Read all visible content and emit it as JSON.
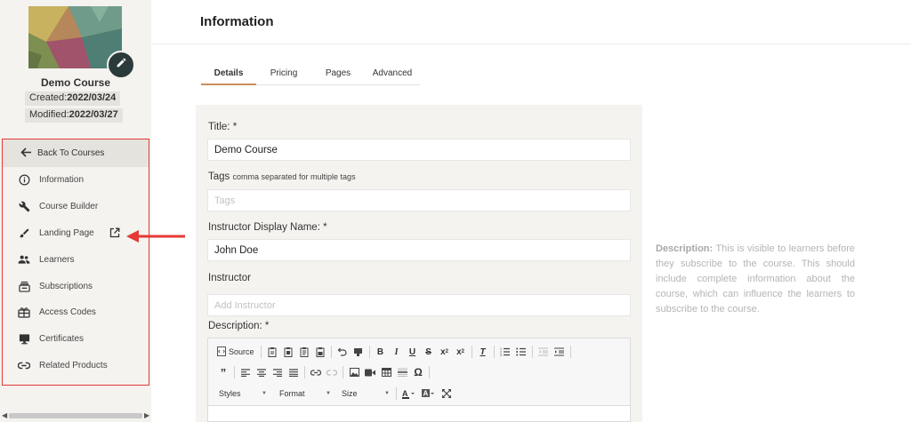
{
  "sidebar": {
    "course_name": "Demo Course",
    "created_label": "Created:",
    "created_value": "2022/03/24",
    "modified_label": "Modified:",
    "modified_value": "2022/03/27",
    "back_label": "Back To Courses",
    "items": [
      {
        "label": "Information",
        "icon": "info-icon"
      },
      {
        "label": "Course Builder",
        "icon": "wrench-icon"
      },
      {
        "label": "Landing Page",
        "icon": "brush-icon"
      },
      {
        "label": "Learners",
        "icon": "people-icon"
      },
      {
        "label": "Subscriptions",
        "icon": "subscriptions-icon"
      },
      {
        "label": "Access Codes",
        "icon": "gift-icon"
      },
      {
        "label": "Certificates",
        "icon": "monitor-icon"
      },
      {
        "label": "Related Products",
        "icon": "link-icon"
      }
    ]
  },
  "header": {
    "title": "Information"
  },
  "tabs": [
    {
      "label": "Details",
      "active": true
    },
    {
      "label": "Pricing",
      "active": false
    },
    {
      "label": "Pages",
      "active": false
    },
    {
      "label": "Advanced",
      "active": false
    }
  ],
  "form": {
    "title_label": "Title: *",
    "title_value": "Demo Course",
    "tags_label": "Tags",
    "tags_hint": "comma separated for multiple tags",
    "tags_placeholder": "Tags",
    "instructor_display_label": "Instructor Display Name: *",
    "instructor_display_value": "John Doe",
    "instructor_label": "Instructor",
    "instructor_placeholder": "Add Instructor",
    "description_label": "Description: *"
  },
  "editor": {
    "source_label": "Source",
    "styles_label": "Styles",
    "format_label": "Format",
    "size_label": "Size"
  },
  "help": {
    "heading": "Description:",
    "text": "This is visible to learners before they subscribe to the course. This should include complete information about the course, which can influence the learners to subscribe to the course."
  },
  "colors": {
    "sidebar_bg": "#f4f3ef",
    "highlight_border": "#e53935",
    "tab_accent": "#c98d5b",
    "edit_button": "#2b3a3a"
  }
}
